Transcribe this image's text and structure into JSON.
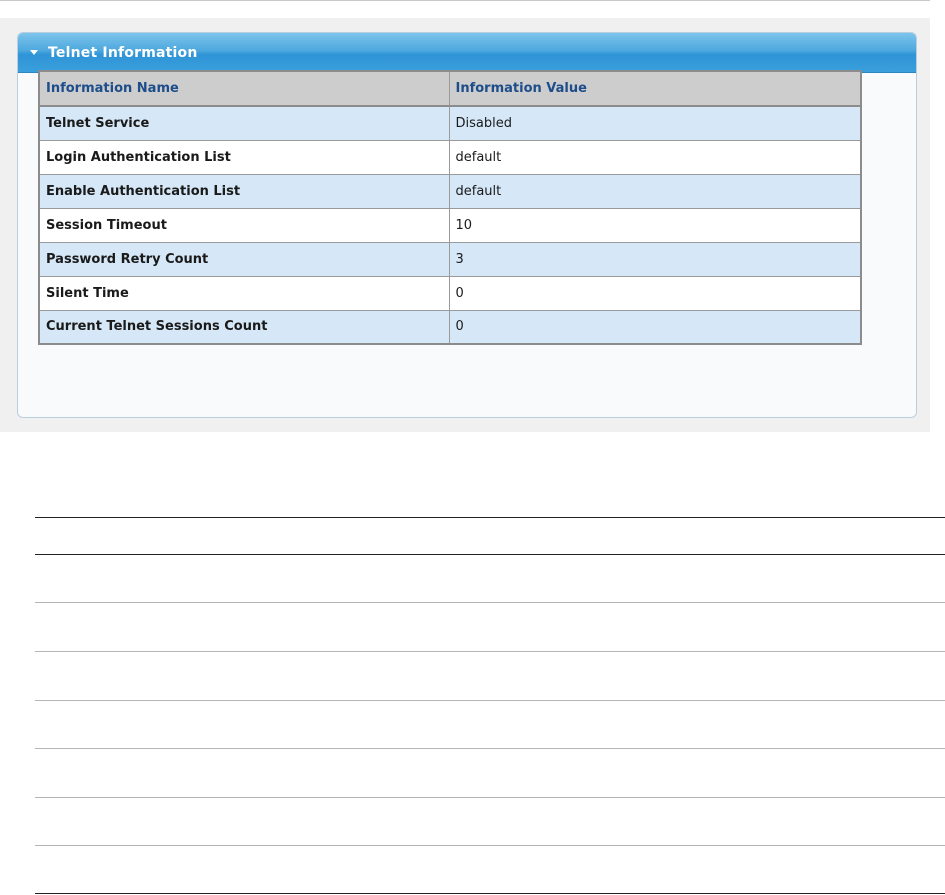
{
  "panel": {
    "title": "Telnet Information"
  },
  "table": {
    "headers": [
      "Information Name",
      "Information Value"
    ],
    "rows": [
      {
        "name": "Telnet Service",
        "value": "Disabled"
      },
      {
        "name": "Login Authentication List",
        "value": "default"
      },
      {
        "name": "Enable Authentication List",
        "value": "default"
      },
      {
        "name": "Session Timeout",
        "value": "10"
      },
      {
        "name": "Password Retry Count",
        "value": "3"
      },
      {
        "name": "Silent Time",
        "value": "0"
      },
      {
        "name": "Current Telnet Sessions Count",
        "value": "0"
      }
    ]
  },
  "colors": {
    "header_gradient_top": "#7cc4ec",
    "header_gradient_bottom": "#2f94d6",
    "table_header_bg": "#cdcdcd",
    "table_header_text": "#1d4d8a",
    "row_alt_bg": "#d6e8f8"
  }
}
